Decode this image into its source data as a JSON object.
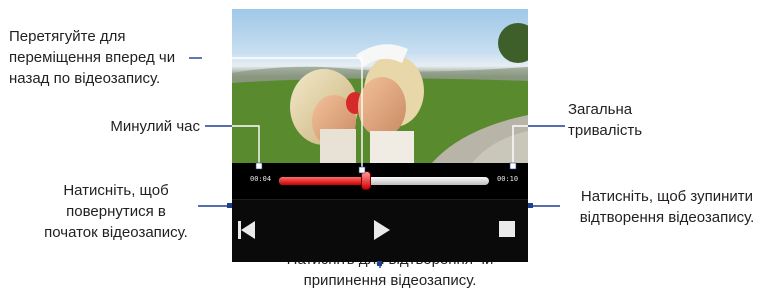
{
  "player": {
    "elapsed": "00:04",
    "total": "00:10",
    "progress_fraction": 0.414
  },
  "annotations": {
    "drag": [
      "Перетягуйте для",
      "переміщення вперед чи",
      "назад по відеозапису."
    ],
    "elapsed": [
      "Минулий час"
    ],
    "total": [
      "Загальна",
      "тривалість"
    ],
    "restart": [
      "Натисніть, щоб",
      "повернутися в",
      "початок відеозапису."
    ],
    "stop": [
      "Натисніть, щоб зупинити",
      "відтворення відеозапису."
    ],
    "play": [
      "Натисніть для відтворення чи",
      "припинення відеозапису."
    ]
  },
  "icons": {
    "previous": "skip-to-start-icon",
    "play": "play-icon",
    "stop": "stop-icon"
  },
  "colors": {
    "callout_line": "#1f3f8f",
    "progress_red": "#c80000"
  }
}
